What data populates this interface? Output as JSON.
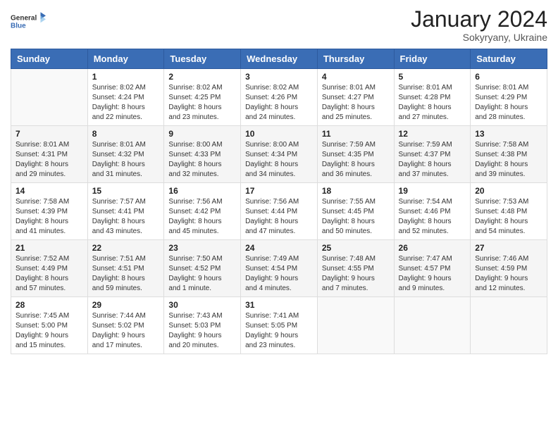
{
  "logo": {
    "line1": "General",
    "line2": "Blue"
  },
  "title": "January 2024",
  "subtitle": "Sokyryany, Ukraine",
  "days_header": [
    "Sunday",
    "Monday",
    "Tuesday",
    "Wednesday",
    "Thursday",
    "Friday",
    "Saturday"
  ],
  "weeks": [
    [
      {
        "num": "",
        "info": ""
      },
      {
        "num": "1",
        "info": "Sunrise: 8:02 AM\nSunset: 4:24 PM\nDaylight: 8 hours\nand 22 minutes."
      },
      {
        "num": "2",
        "info": "Sunrise: 8:02 AM\nSunset: 4:25 PM\nDaylight: 8 hours\nand 23 minutes."
      },
      {
        "num": "3",
        "info": "Sunrise: 8:02 AM\nSunset: 4:26 PM\nDaylight: 8 hours\nand 24 minutes."
      },
      {
        "num": "4",
        "info": "Sunrise: 8:01 AM\nSunset: 4:27 PM\nDaylight: 8 hours\nand 25 minutes."
      },
      {
        "num": "5",
        "info": "Sunrise: 8:01 AM\nSunset: 4:28 PM\nDaylight: 8 hours\nand 27 minutes."
      },
      {
        "num": "6",
        "info": "Sunrise: 8:01 AM\nSunset: 4:29 PM\nDaylight: 8 hours\nand 28 minutes."
      }
    ],
    [
      {
        "num": "7",
        "info": "Sunrise: 8:01 AM\nSunset: 4:31 PM\nDaylight: 8 hours\nand 29 minutes."
      },
      {
        "num": "8",
        "info": "Sunrise: 8:01 AM\nSunset: 4:32 PM\nDaylight: 8 hours\nand 31 minutes."
      },
      {
        "num": "9",
        "info": "Sunrise: 8:00 AM\nSunset: 4:33 PM\nDaylight: 8 hours\nand 32 minutes."
      },
      {
        "num": "10",
        "info": "Sunrise: 8:00 AM\nSunset: 4:34 PM\nDaylight: 8 hours\nand 34 minutes."
      },
      {
        "num": "11",
        "info": "Sunrise: 7:59 AM\nSunset: 4:35 PM\nDaylight: 8 hours\nand 36 minutes."
      },
      {
        "num": "12",
        "info": "Sunrise: 7:59 AM\nSunset: 4:37 PM\nDaylight: 8 hours\nand 37 minutes."
      },
      {
        "num": "13",
        "info": "Sunrise: 7:58 AM\nSunset: 4:38 PM\nDaylight: 8 hours\nand 39 minutes."
      }
    ],
    [
      {
        "num": "14",
        "info": "Sunrise: 7:58 AM\nSunset: 4:39 PM\nDaylight: 8 hours\nand 41 minutes."
      },
      {
        "num": "15",
        "info": "Sunrise: 7:57 AM\nSunset: 4:41 PM\nDaylight: 8 hours\nand 43 minutes."
      },
      {
        "num": "16",
        "info": "Sunrise: 7:56 AM\nSunset: 4:42 PM\nDaylight: 8 hours\nand 45 minutes."
      },
      {
        "num": "17",
        "info": "Sunrise: 7:56 AM\nSunset: 4:44 PM\nDaylight: 8 hours\nand 47 minutes."
      },
      {
        "num": "18",
        "info": "Sunrise: 7:55 AM\nSunset: 4:45 PM\nDaylight: 8 hours\nand 50 minutes."
      },
      {
        "num": "19",
        "info": "Sunrise: 7:54 AM\nSunset: 4:46 PM\nDaylight: 8 hours\nand 52 minutes."
      },
      {
        "num": "20",
        "info": "Sunrise: 7:53 AM\nSunset: 4:48 PM\nDaylight: 8 hours\nand 54 minutes."
      }
    ],
    [
      {
        "num": "21",
        "info": "Sunrise: 7:52 AM\nSunset: 4:49 PM\nDaylight: 8 hours\nand 57 minutes."
      },
      {
        "num": "22",
        "info": "Sunrise: 7:51 AM\nSunset: 4:51 PM\nDaylight: 8 hours\nand 59 minutes."
      },
      {
        "num": "23",
        "info": "Sunrise: 7:50 AM\nSunset: 4:52 PM\nDaylight: 9 hours\nand 1 minute."
      },
      {
        "num": "24",
        "info": "Sunrise: 7:49 AM\nSunset: 4:54 PM\nDaylight: 9 hours\nand 4 minutes."
      },
      {
        "num": "25",
        "info": "Sunrise: 7:48 AM\nSunset: 4:55 PM\nDaylight: 9 hours\nand 7 minutes."
      },
      {
        "num": "26",
        "info": "Sunrise: 7:47 AM\nSunset: 4:57 PM\nDaylight: 9 hours\nand 9 minutes."
      },
      {
        "num": "27",
        "info": "Sunrise: 7:46 AM\nSunset: 4:59 PM\nDaylight: 9 hours\nand 12 minutes."
      }
    ],
    [
      {
        "num": "28",
        "info": "Sunrise: 7:45 AM\nSunset: 5:00 PM\nDaylight: 9 hours\nand 15 minutes."
      },
      {
        "num": "29",
        "info": "Sunrise: 7:44 AM\nSunset: 5:02 PM\nDaylight: 9 hours\nand 17 minutes."
      },
      {
        "num": "30",
        "info": "Sunrise: 7:43 AM\nSunset: 5:03 PM\nDaylight: 9 hours\nand 20 minutes."
      },
      {
        "num": "31",
        "info": "Sunrise: 7:41 AM\nSunset: 5:05 PM\nDaylight: 9 hours\nand 23 minutes."
      },
      {
        "num": "",
        "info": ""
      },
      {
        "num": "",
        "info": ""
      },
      {
        "num": "",
        "info": ""
      }
    ]
  ]
}
